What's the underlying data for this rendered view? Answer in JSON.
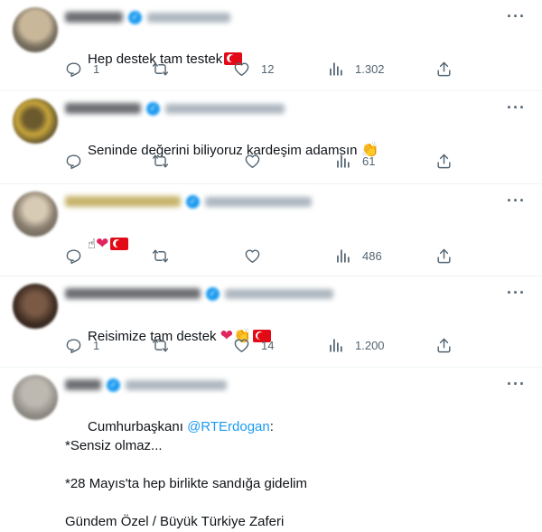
{
  "tweets": [
    {
      "text": "Hep destek tam testek",
      "emojis": [
        "flag-tr"
      ],
      "counts": {
        "reply": "1",
        "retweet": "",
        "like": "12",
        "views": "1.302"
      }
    },
    {
      "text": "Seninde değerini biliyoruz kardeşim adamsın",
      "emojis": [
        "clap"
      ],
      "counts": {
        "reply": "",
        "retweet": "",
        "like": "",
        "views": "61"
      }
    },
    {
      "text": "",
      "emojis": [
        "point-up",
        "heart",
        "flag-tr"
      ],
      "counts": {
        "reply": "",
        "retweet": "",
        "like": "",
        "views": "486"
      }
    },
    {
      "text": "Reisimize tam destek",
      "emojis": [
        "heart",
        "clap",
        "flag-tr"
      ],
      "counts": {
        "reply": "1",
        "retweet": "",
        "like": "14",
        "views": "1.200"
      }
    },
    {
      "text_prefix": "Cumhurbaşkanı ",
      "mention": "@RTErdogan",
      "text_suffix": ":",
      "lines": [
        "*Sensiz olmaz...",
        "*28 Mayıs'ta hep birlikte sandığa gidelim",
        "Gündem Özel / Büyük Türkiye Zaferi"
      ]
    }
  ],
  "icons": {
    "reply": "reply-icon",
    "retweet": "retweet-icon",
    "like": "heart-icon",
    "views": "views-icon",
    "share": "share-icon",
    "more": "more-icon"
  },
  "colors": {
    "text": "#0f1419",
    "secondary": "#536471",
    "accent": "#1d9bf0",
    "divider": "#eff3f4"
  }
}
